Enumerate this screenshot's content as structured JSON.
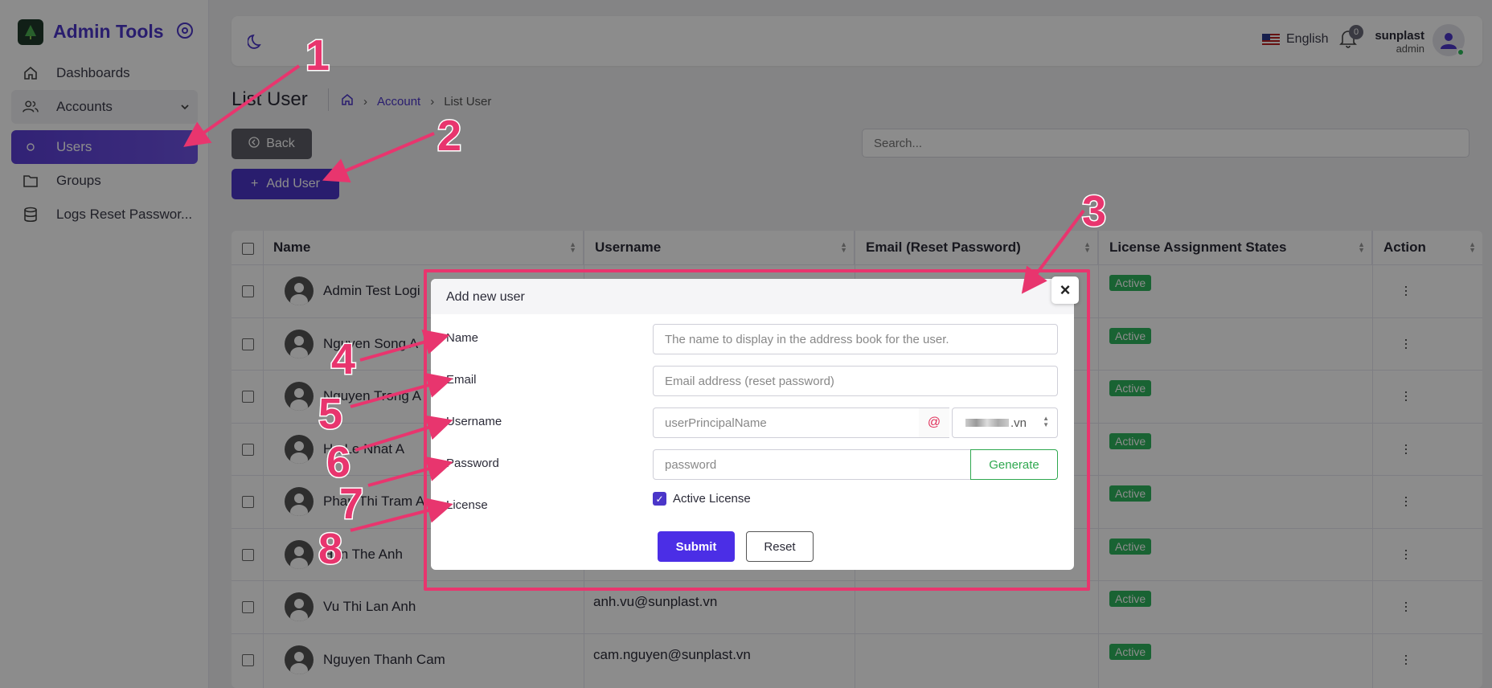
{
  "sidebar": {
    "brand": "Admin Tools",
    "items": [
      {
        "label": "Dashboards",
        "icon": "home-icon"
      },
      {
        "label": "Accounts",
        "icon": "users-icon"
      },
      {
        "label": "Users",
        "icon": "circle-icon"
      },
      {
        "label": "Groups",
        "icon": "folder-icon"
      },
      {
        "label": "Logs Reset Passwor..."
      }
    ]
  },
  "topbar": {
    "language": "English",
    "notif_count": "0",
    "user_name": "sunplast",
    "user_role": "admin"
  },
  "page": {
    "title": "List User",
    "breadcrumb": [
      "Account",
      "List User"
    ],
    "back_label": "Back",
    "add_label": "Add User",
    "search_placeholder": "Search..."
  },
  "table": {
    "headers": [
      "Name",
      "Username",
      "Email (Reset Password)",
      "License Assignment States",
      "Action"
    ],
    "rows": [
      {
        "name": "Admin Test Logi",
        "username": "",
        "status": "Active"
      },
      {
        "name": "Nguyen Song A",
        "username": "",
        "status": "Active"
      },
      {
        "name": "Nguyen Trong A",
        "username": "",
        "status": "Active"
      },
      {
        "name": "Ha Le Nhat A",
        "username": "",
        "status": "Active"
      },
      {
        "name": "Phan Thi Tram A",
        "username": "",
        "status": "Active"
      },
      {
        "name": "Han The Anh",
        "username": "",
        "status": "Active"
      },
      {
        "name": "Vu Thi Lan Anh",
        "username": "anh.vu@sunplast.vn",
        "status": "Active"
      },
      {
        "name": "Nguyen Thanh Cam",
        "username": "cam.nguyen@sunplast.vn",
        "status": "Active"
      }
    ]
  },
  "modal": {
    "title": "Add new user",
    "close": "×",
    "name_label": "Name",
    "name_placeholder": "The name to display in the address book for the user.",
    "email_label": "Email",
    "email_placeholder": "Email address (reset password)",
    "username_label": "Username",
    "username_placeholder": "userPrincipalName",
    "at": "@",
    "domain_suffix": ".vn",
    "password_label": "Password",
    "password_placeholder": "password",
    "generate_label": "Generate",
    "license_label": "License",
    "license_checkbox": "Active License",
    "submit_label": "Submit",
    "reset_label": "Reset"
  },
  "annotations": [
    "1",
    "2",
    "3",
    "4",
    "5",
    "6",
    "7",
    "8"
  ],
  "colors": {
    "accent": "#4b36c9",
    "annotation": "#e8356e",
    "status": "#2fb55d"
  }
}
